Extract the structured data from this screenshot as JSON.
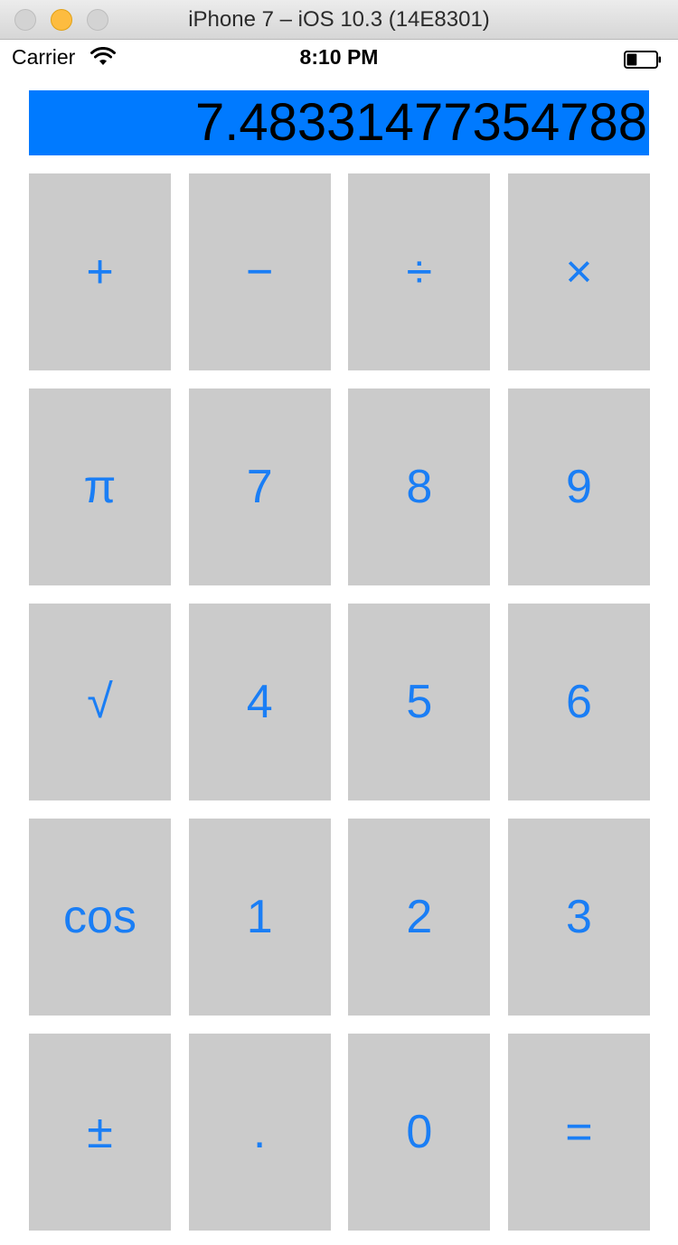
{
  "window": {
    "title": "iPhone 7 – iOS 10.3 (14E8301)"
  },
  "status_bar": {
    "carrier": "Carrier",
    "time": "8:10 PM",
    "wifi_icon": "wifi-icon",
    "battery_icon": "battery-icon",
    "battery_level": 0.35
  },
  "display": {
    "value": "7.48331477354788",
    "background": "#007aff",
    "text_color": "#000000"
  },
  "keypad": {
    "key_background": "#cbcbcb",
    "key_text_color": "#1a7ef5",
    "rows": [
      [
        "+",
        "−",
        "÷",
        "×"
      ],
      [
        "π",
        "7",
        "8",
        "9"
      ],
      [
        "√",
        "4",
        "5",
        "6"
      ],
      [
        "cos",
        "1",
        "2",
        "3"
      ],
      [
        "±",
        ".",
        "0",
        "="
      ]
    ]
  }
}
